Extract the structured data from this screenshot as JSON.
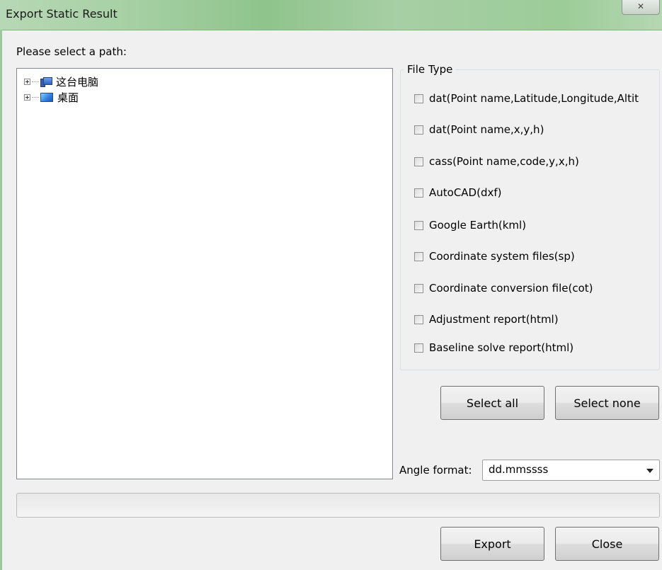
{
  "window": {
    "title": "Export Static Result",
    "close_glyph": "✕"
  },
  "path_label": "Please select a path:",
  "tree": [
    {
      "label": "这台电脑",
      "icon": "computer-icon"
    },
    {
      "label": "桌面",
      "icon": "desktop-icon"
    }
  ],
  "file_type": {
    "legend": "File Type",
    "options": [
      {
        "label": "dat(Point name,Latitude,Longitude,Altit",
        "checked": false
      },
      {
        "label": "dat(Point name,x,y,h)",
        "checked": false
      },
      {
        "label": "cass(Point name,code,y,x,h)",
        "checked": false
      },
      {
        "label": "AutoCAD(dxf)",
        "checked": false
      },
      {
        "label": "Google Earth(kml)",
        "checked": false
      },
      {
        "label": "Coordinate system files(sp)",
        "checked": false
      },
      {
        "label": "Coordinate conversion file(cot)",
        "checked": false
      },
      {
        "label": "Adjustment report(html)",
        "checked": false
      },
      {
        "label": "Baseline solve report(html)",
        "checked": false
      }
    ]
  },
  "buttons": {
    "select_all": "Select all",
    "select_none": "Select none",
    "export": "Export",
    "close": "Close"
  },
  "angle_format": {
    "label": "Angle format:",
    "value": "dd.mmssss"
  },
  "progress": {
    "value": 0
  }
}
